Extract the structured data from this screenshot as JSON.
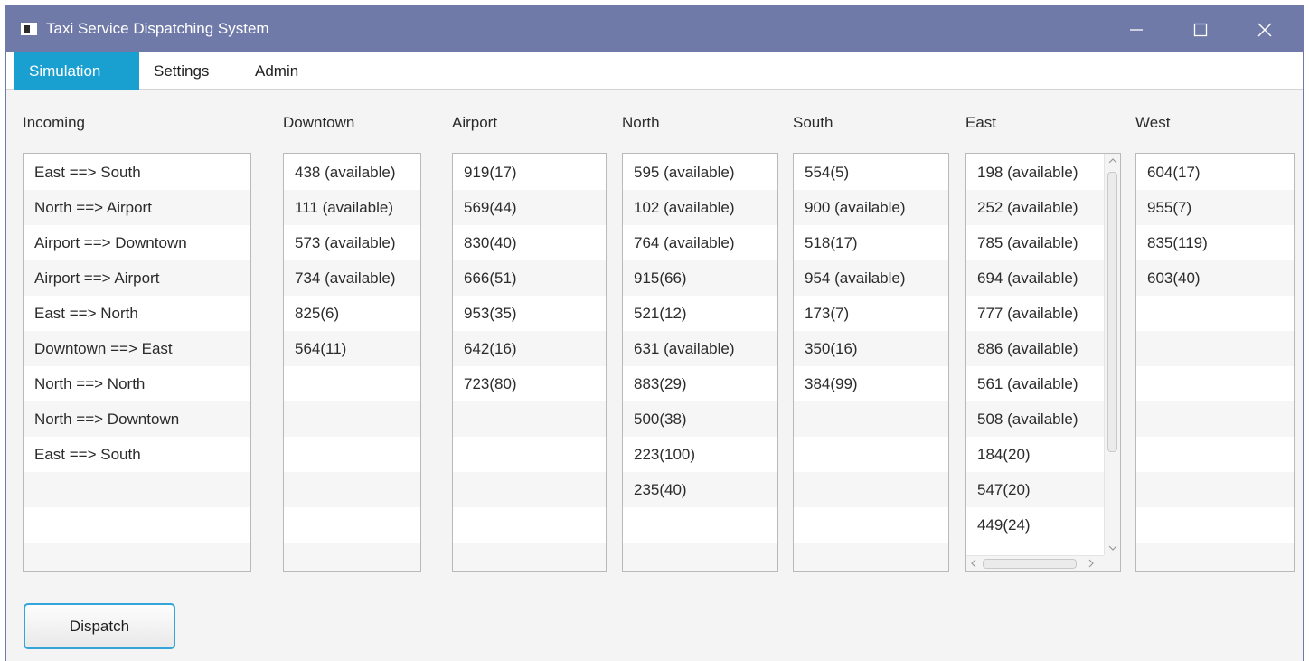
{
  "window": {
    "title": "Taxi Service Dispatching System"
  },
  "menu": {
    "items": [
      "Simulation",
      "Settings",
      "Admin"
    ],
    "active": "Simulation"
  },
  "columns": {
    "incoming": {
      "header": "Incoming",
      "rows": [
        "East ==> South",
        "North ==> Airport",
        "Airport ==> Downtown",
        "Airport ==> Airport",
        "East ==> North",
        "Downtown ==> East",
        "North ==> North",
        "North ==> Downtown",
        "East ==> South"
      ]
    },
    "downtown": {
      "header": "Downtown",
      "rows": [
        "438 (available)",
        "111 (available)",
        "573 (available)",
        "734 (available)",
        "825(6)",
        "564(11)"
      ]
    },
    "airport": {
      "header": "Airport",
      "rows": [
        "919(17)",
        "569(44)",
        "830(40)",
        "666(51)",
        "953(35)",
        "642(16)",
        "723(80)"
      ]
    },
    "north": {
      "header": "North",
      "rows": [
        "595 (available)",
        "102 (available)",
        "764 (available)",
        "915(66)",
        "521(12)",
        "631 (available)",
        "883(29)",
        "500(38)",
        "223(100)",
        "235(40)"
      ]
    },
    "south": {
      "header": "South",
      "rows": [
        "554(5)",
        "900 (available)",
        "518(17)",
        "954 (available)",
        "173(7)",
        "350(16)",
        "384(99)"
      ]
    },
    "east": {
      "header": "East",
      "rows": [
        "198 (available)",
        "252 (available)",
        "785 (available)",
        "694 (available)",
        "777 (available)",
        "886 (available)",
        "561 (available)",
        "508 (available)",
        "184(20)",
        "547(20)",
        "449(24)"
      ]
    },
    "west": {
      "header": "West",
      "rows": [
        "604(17)",
        "955(7)",
        "835(119)",
        "603(40)"
      ]
    }
  },
  "dispatch_button": {
    "label": "Dispatch"
  },
  "colors": {
    "titlebar": "#6f7aa8",
    "menu_active": "#1aa0d0",
    "button_focus": "#34a5d8"
  }
}
